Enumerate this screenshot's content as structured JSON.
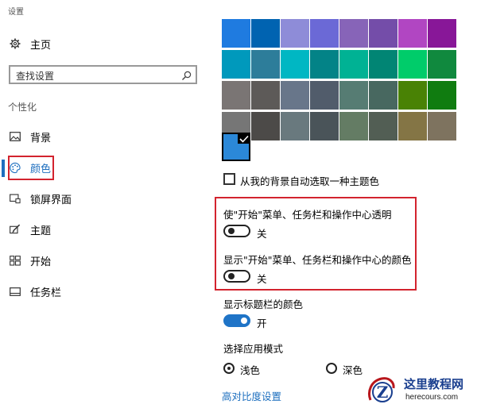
{
  "app": {
    "title": "设置"
  },
  "sidebar": {
    "home_label": "主页",
    "search_placeholder": "查找设置",
    "section": "个性化",
    "items": [
      {
        "label": "背景",
        "icon": "picture-icon"
      },
      {
        "label": "颜色",
        "icon": "palette-icon",
        "selected": true
      },
      {
        "label": "锁屏界面",
        "icon": "lock-screen-icon"
      },
      {
        "label": "主题",
        "icon": "brush-icon"
      },
      {
        "label": "开始",
        "icon": "start-grid-icon"
      },
      {
        "label": "任务栏",
        "icon": "taskbar-icon"
      }
    ]
  },
  "colors": {
    "grid": [
      [
        "#1f7be0",
        "#0063b1",
        "#8e8cd8",
        "#6b69d6",
        "#8764b8",
        "#744da9",
        "#b146c2",
        "#881798"
      ],
      [
        "#0099bc",
        "#2d7d9a",
        "#00b7c3",
        "#038387",
        "#00b294",
        "#018574",
        "#00cc6a",
        "#10893e"
      ],
      [
        "#7a7574",
        "#5d5a58",
        "#68768a",
        "#515c6b",
        "#567c73",
        "#486860",
        "#498205",
        "#107c10"
      ],
      [
        "#767676",
        "#4c4a48",
        "#69797e",
        "#4a5459",
        "#647c64",
        "#525e54",
        "#847545",
        "#7e735f"
      ]
    ],
    "selected": "#2b88d8",
    "auto_pick_label": "从我的背景自动选取一种主题色"
  },
  "transparency": {
    "label": "使\"开始\"菜单、任务栏和操作中心透明",
    "state": "关"
  },
  "show_color": {
    "label": "显示\"开始\"菜单、任务栏和操作中心的颜色",
    "state": "关"
  },
  "title_bar": {
    "label": "显示标题栏的颜色",
    "state": "开"
  },
  "app_mode": {
    "label": "选择应用模式",
    "options": [
      {
        "label": "浅色",
        "selected": true
      },
      {
        "label": "深色",
        "selected": false
      }
    ]
  },
  "high_contrast_link": "高对比度设置",
  "watermark": {
    "name": "这里教程网",
    "url": "herecours.com"
  },
  "accent_colors": {
    "highlight_border": "#d3232e",
    "toggle_on": "#1f74c7",
    "link": "#1d6fbf"
  }
}
